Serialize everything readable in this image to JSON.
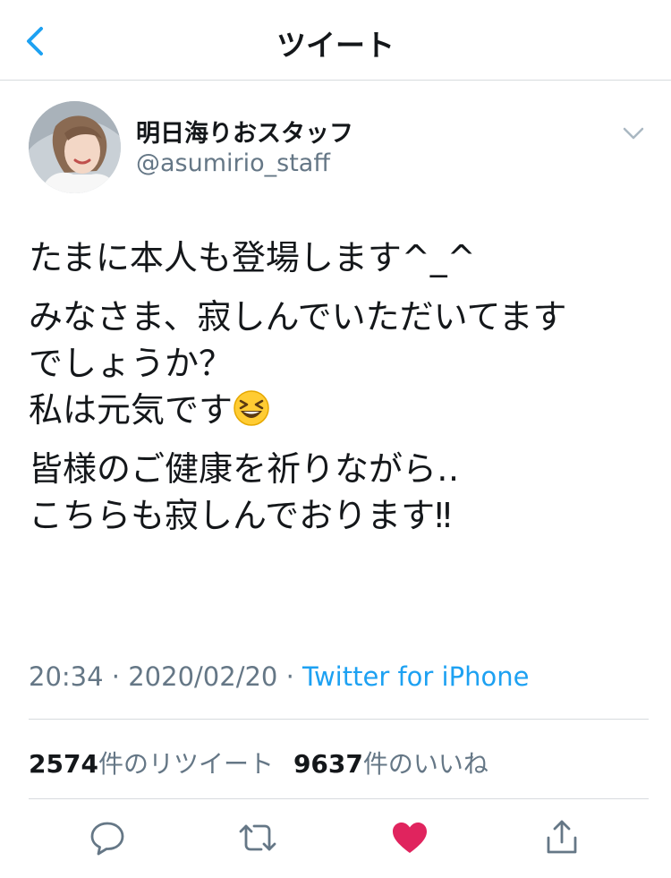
{
  "nav": {
    "back_icon": "chevron-left-icon",
    "title": "ツイート"
  },
  "author": {
    "display_name": "明日海りおスタッフ",
    "handle": "@asumirio_staff",
    "menu_icon": "chevron-down-icon"
  },
  "tweet": {
    "paragraphs": [
      [
        "たまに本人も登場します^_^"
      ],
      [
        "みなさま、寂しんでいただいてます",
        "でしょうか？",
        "私は元気です"
      ],
      [
        "皆様のご健康を祈りながら‥",
        "こちらも寂しんでおります‼"
      ]
    ],
    "emoji": "grinning-squinting-face"
  },
  "meta": {
    "time": "20:34",
    "date": "2020/02/20",
    "separator": "·",
    "source": "Twitter for iPhone"
  },
  "stats": {
    "retweets_count": "2574",
    "retweets_label": "件のリツイート",
    "likes_count": "9637",
    "likes_label": "件のいいね"
  },
  "actions": {
    "reply_icon": "reply-icon",
    "retweet_icon": "retweet-icon",
    "like_icon": "heart-icon",
    "share_icon": "share-icon",
    "liked": true
  },
  "colors": {
    "accent": "#1da1f2",
    "like": "#e0245e",
    "secondary_text": "#657786",
    "divider": "#d7dbde"
  }
}
